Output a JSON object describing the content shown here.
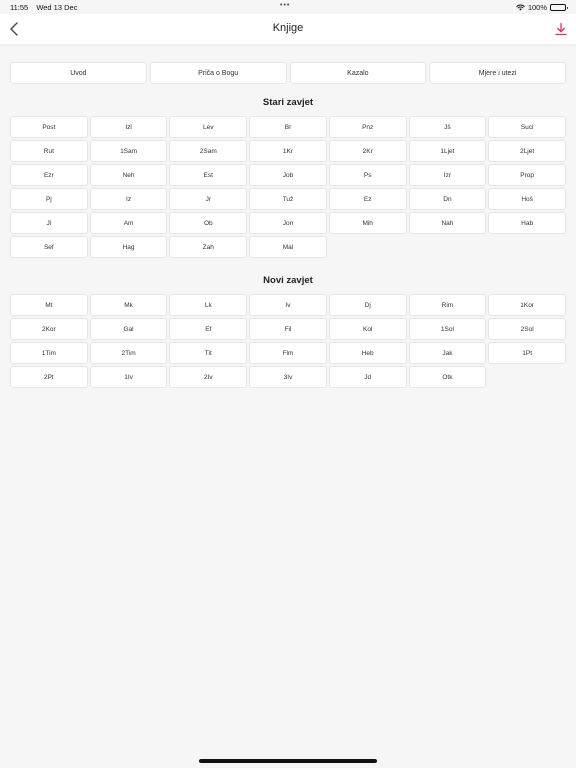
{
  "status_bar": {
    "time": "11:55",
    "date": "Wed 13 Dec",
    "center_dots": "•••",
    "battery": "100%",
    "icons": [
      "wifi-icon",
      "battery-icon"
    ]
  },
  "nav": {
    "title": "Knjige",
    "back_icon": "chevron-left-icon",
    "download_icon": "download-icon",
    "accent_color": "#d6335a"
  },
  "tabs": [
    {
      "label": "Uvod"
    },
    {
      "label": "Priča o Bogu"
    },
    {
      "label": "Kazalo"
    },
    {
      "label": "Mjere i utezi"
    }
  ],
  "old_testament": {
    "title": "Stari zavjet",
    "books": [
      "Post",
      "Izl",
      "Lev",
      "Br",
      "Pnz",
      "Jš",
      "Suci",
      "Rut",
      "1Sam",
      "2Sam",
      "1Kr",
      "2Kr",
      "1Ljet",
      "2Ljet",
      "Ezr",
      "Neh",
      "Est",
      "Job",
      "Ps",
      "Izr",
      "Prop",
      "Pj",
      "Iz",
      "Jr",
      "Tuž",
      "Ez",
      "Dn",
      "Hoš",
      "Jl",
      "Am",
      "Ob",
      "Jon",
      "Mih",
      "Nah",
      "Hab",
      "Sef",
      "Hag",
      "Zah",
      "Mal"
    ]
  },
  "new_testament": {
    "title": "Novi zavjet",
    "books": [
      "Mt",
      "Mk",
      "Lk",
      "Iv",
      "Dj",
      "Rim",
      "1Kor",
      "2Kor",
      "Gal",
      "Ef",
      "Fil",
      "Kol",
      "1Sol",
      "2Sol",
      "1Tim",
      "2Tim",
      "Tit",
      "Flm",
      "Heb",
      "Jak",
      "1Pt",
      "2Pt",
      "1Iv",
      "2Iv",
      "3Iv",
      "Jd",
      "Otk"
    ]
  }
}
